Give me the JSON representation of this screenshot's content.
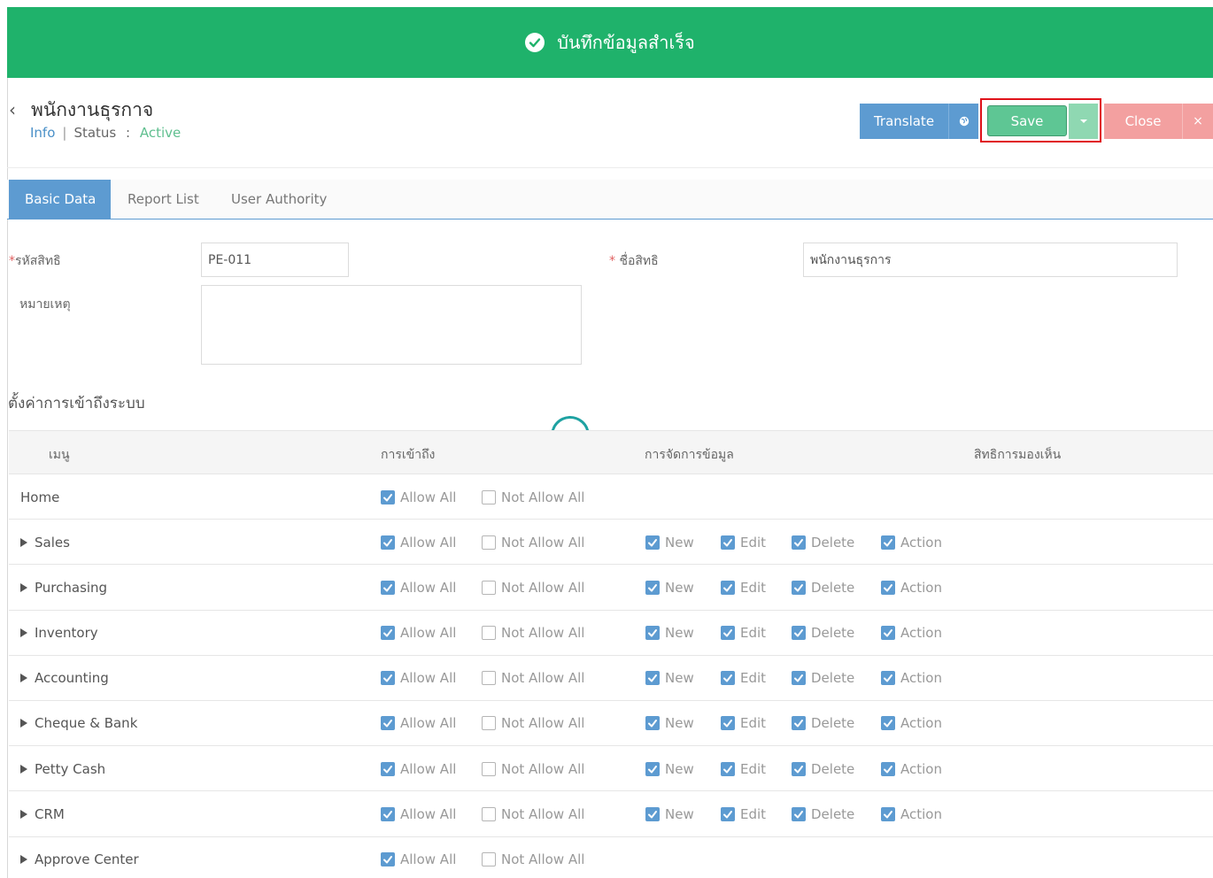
{
  "toast": {
    "message": "บันทึกข้อมูลสำเร็จ"
  },
  "header": {
    "title": "พนักงานธุรกาจ",
    "info_link": "Info",
    "status_label": "Status",
    "status_sep": ":",
    "status_value": "Active"
  },
  "toolbar": {
    "translate_label": "Translate",
    "save_label": "Save",
    "close_label": "Close",
    "close_x": "×"
  },
  "tabs": [
    {
      "label": "Basic Data"
    },
    {
      "label": "Report List"
    },
    {
      "label": "User Authority"
    }
  ],
  "form": {
    "code_label": "รหัสสิทธิ",
    "code_value": "PE-011",
    "name_label": "ชื่อสิทธิ",
    "name_value": "พนักงานธุรการ",
    "note_label": "หมายเหตุ",
    "note_value": "",
    "required_mark": "*"
  },
  "access": {
    "section_title": "ตั้งค่าการเข้าถึงระบบ",
    "headers": {
      "menu": "เมนู",
      "access": "การเข้าถึง",
      "data": "การจัดการข้อมูล",
      "visibility": "สิทธิการมองเห็น"
    },
    "labels": {
      "allow_all": "Allow All",
      "not_allow_all": "Not Allow All",
      "new": "New",
      "edit": "Edit",
      "delete": "Delete",
      "action": "Action"
    },
    "rows": [
      {
        "name": "Home",
        "expandable": false,
        "allow_all": true,
        "not_allow_all": false,
        "has_data_perms": false
      },
      {
        "name": "Sales",
        "expandable": true,
        "allow_all": true,
        "not_allow_all": false,
        "has_data_perms": true,
        "new": true,
        "edit": true,
        "delete": true,
        "action": true
      },
      {
        "name": "Purchasing",
        "expandable": true,
        "allow_all": true,
        "not_allow_all": false,
        "has_data_perms": true,
        "new": true,
        "edit": true,
        "delete": true,
        "action": true
      },
      {
        "name": "Inventory",
        "expandable": true,
        "allow_all": true,
        "not_allow_all": false,
        "has_data_perms": true,
        "new": true,
        "edit": true,
        "delete": true,
        "action": true
      },
      {
        "name": "Accounting",
        "expandable": true,
        "allow_all": true,
        "not_allow_all": false,
        "has_data_perms": true,
        "new": true,
        "edit": true,
        "delete": true,
        "action": true
      },
      {
        "name": "Cheque & Bank",
        "expandable": true,
        "allow_all": true,
        "not_allow_all": false,
        "has_data_perms": true,
        "new": true,
        "edit": true,
        "delete": true,
        "action": true
      },
      {
        "name": "Petty Cash",
        "expandable": true,
        "allow_all": true,
        "not_allow_all": false,
        "has_data_perms": true,
        "new": true,
        "edit": true,
        "delete": true,
        "action": true
      },
      {
        "name": "CRM",
        "expandable": true,
        "allow_all": true,
        "not_allow_all": false,
        "has_data_perms": true,
        "new": true,
        "edit": true,
        "delete": true,
        "action": true
      },
      {
        "name": "Approve Center",
        "expandable": true,
        "allow_all": true,
        "not_allow_all": false,
        "has_data_perms": false
      }
    ]
  },
  "colors": {
    "success_green": "#1fb26b",
    "primary_blue": "#5d9bd1",
    "save_green": "#5ec694",
    "close_red": "#f3a0a0",
    "highlight_red": "#e0121a"
  }
}
